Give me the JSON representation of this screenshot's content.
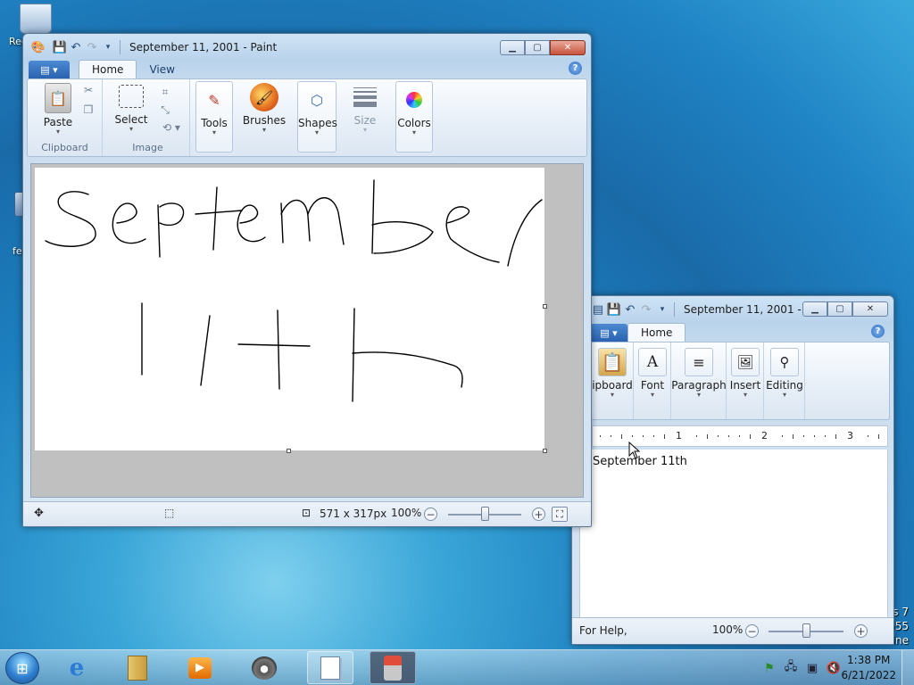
{
  "desktop": {
    "icons": [
      {
        "label": "Rec",
        "icon": "recycle-bin-icon"
      },
      {
        "label": "fe",
        "icon": "shortcut-icon"
      }
    ],
    "watermark_lines": [
      "s 7",
      "555",
      "ine"
    ]
  },
  "paint": {
    "title": "September 11, 2001 - Paint",
    "app_menu_label": "▤ ▾",
    "tabs": [
      "Home",
      "View"
    ],
    "clipboard": {
      "paste": "Paste",
      "group": "Clipboard"
    },
    "image": {
      "select": "Select",
      "group": "Image"
    },
    "tools": "Tools",
    "brushes": "Brushes",
    "shapes": "Shapes",
    "size": "Size",
    "colors": "Colors",
    "status": {
      "dimensions": "571 x 317px",
      "zoom": "100%"
    },
    "zoom_level": 0.5
  },
  "wordpad": {
    "title": "September 11, 2001 - ...",
    "tabs": [
      "Home"
    ],
    "groups": [
      "ipboard",
      "Font",
      "Paragraph",
      "Insert",
      "Editing"
    ],
    "ruler_numbers": [
      "1",
      "2",
      "3"
    ],
    "document_text": "September 11th",
    "status": {
      "help": "For Help,",
      "zoom": "100%"
    },
    "zoom_level": 0.5
  },
  "taskbar": {
    "clock_time": "1:38 PM",
    "clock_date": "6/21/2022",
    "pinned": [
      "internet-explorer-icon",
      "libraries-icon",
      "media-player-icon",
      "raccoon-app-icon",
      "wordpad-icon",
      "paint-icon"
    ]
  }
}
